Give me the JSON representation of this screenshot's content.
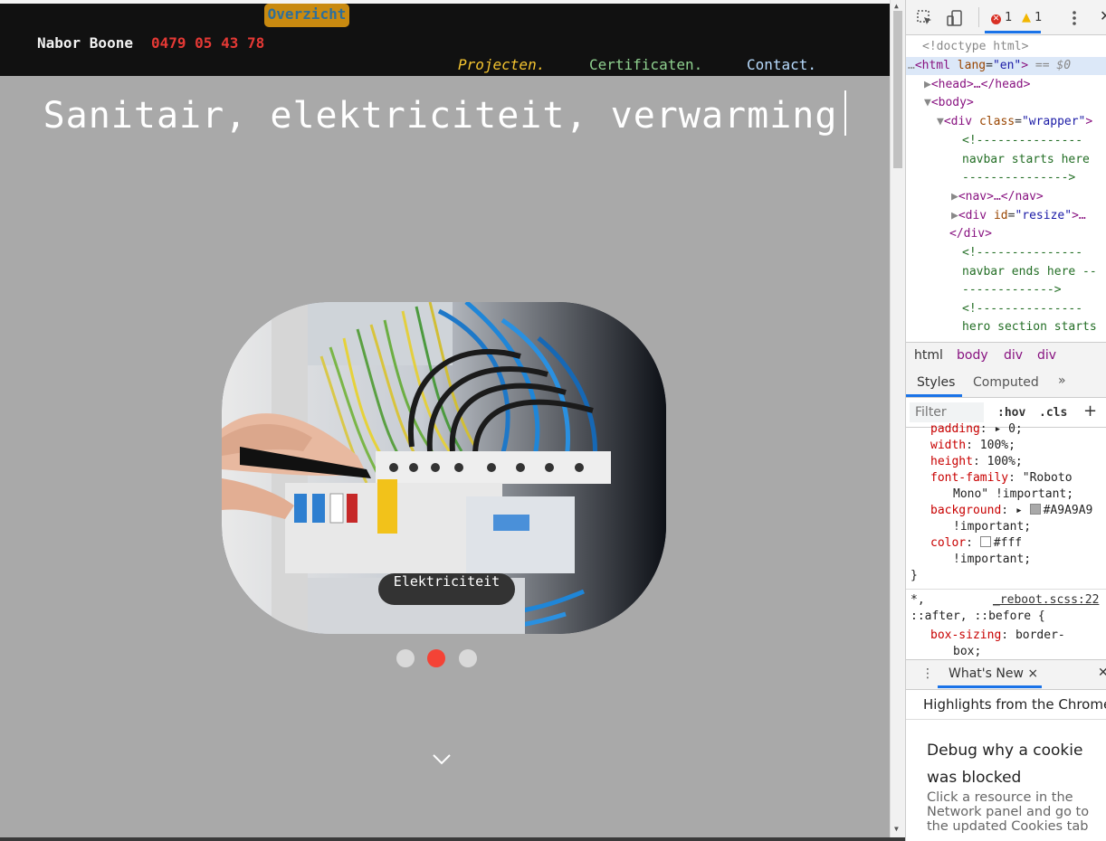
{
  "site": {
    "overzicht_label": "Overzicht",
    "brand_name": "Nabor Boone",
    "phone": "0479 05 43 78",
    "nav": {
      "projecten": "Projecten.",
      "certificaten": "Certificaten.",
      "contact": "Contact."
    },
    "hero_title": "Sanitair, elektriciteit, verwarming",
    "carousel": {
      "caption": "Elektriciteit",
      "active_index": 2,
      "total": 3
    },
    "colors": {
      "background": "#A9A9A9",
      "navbar": "#111111",
      "phone": "#e53935",
      "active_dot": "#f44336"
    }
  },
  "devtools": {
    "error_count": "1",
    "warning_count": "1",
    "dom": {
      "doctype": "<!doctype html>",
      "html_open_tag": "<html",
      "html_attr_name": "lang",
      "html_attr_value": "\"en\"",
      "html_close_bracket": ">",
      "selected_marker": "== $0",
      "head": "<head>…</head>",
      "body": "<body>",
      "div_open": "<div",
      "div_class_attr": "class",
      "div_class_value": "\"wrapper\"",
      "div_close_bracket": ">",
      "comment1_a": "<!---------------",
      "comment1_b": "navbar starts here",
      "comment1_c": "--------------->",
      "nav": "<nav>…</nav>",
      "div_resize_open": "<div",
      "div_resize_attr": "id",
      "div_resize_value": "\"resize\"",
      "div_resize_end": ">…",
      "div_close": "</div>",
      "comment2_a": "<!---------------",
      "comment2_b": "navbar ends here --",
      "comment2_c": "------------->",
      "comment3_a": "<!---------------",
      "comment3_b": "hero section starts"
    },
    "breadcrumbs": [
      "html",
      "body",
      "div",
      "div"
    ],
    "tabs": {
      "styles": "Styles",
      "computed": "Computed",
      "more": "»"
    },
    "filter_placeholder": "Filter",
    "hov": ":hov",
    "cls": ".cls",
    "plus": "+",
    "css_rules": {
      "padding_prop": "padding",
      "padding_val": "▸ 0;",
      "width_prop": "width",
      "width_val": "100%;",
      "height_prop": "height",
      "height_val": "100%;",
      "font_family_prop": "font-family",
      "font_family_val_1": "\"Roboto",
      "font_family_val_2": "Mono\" !important;",
      "background_prop": "background",
      "background_val": "#A9A9A9",
      "background_important": "!important;",
      "color_prop": "color",
      "color_val": "#fff",
      "color_important": "!important;",
      "close_brace": "}",
      "rule2_selector": "*,",
      "rule2_source": "_reboot.scss:22",
      "rule2_pseudo": "::after, ::before {",
      "box_sizing_prop": "box-sizing",
      "box_sizing_val_1": "border-",
      "box_sizing_val_2": "box;"
    },
    "drawer": {
      "whats_new_tab": "What's New",
      "close": "×",
      "highlights": "Highlights from the Chrome ...",
      "news_title": "Debug why a cookie was blocked",
      "news_body": "Click a resource in the Network panel and go to the updated Cookies tab"
    }
  }
}
